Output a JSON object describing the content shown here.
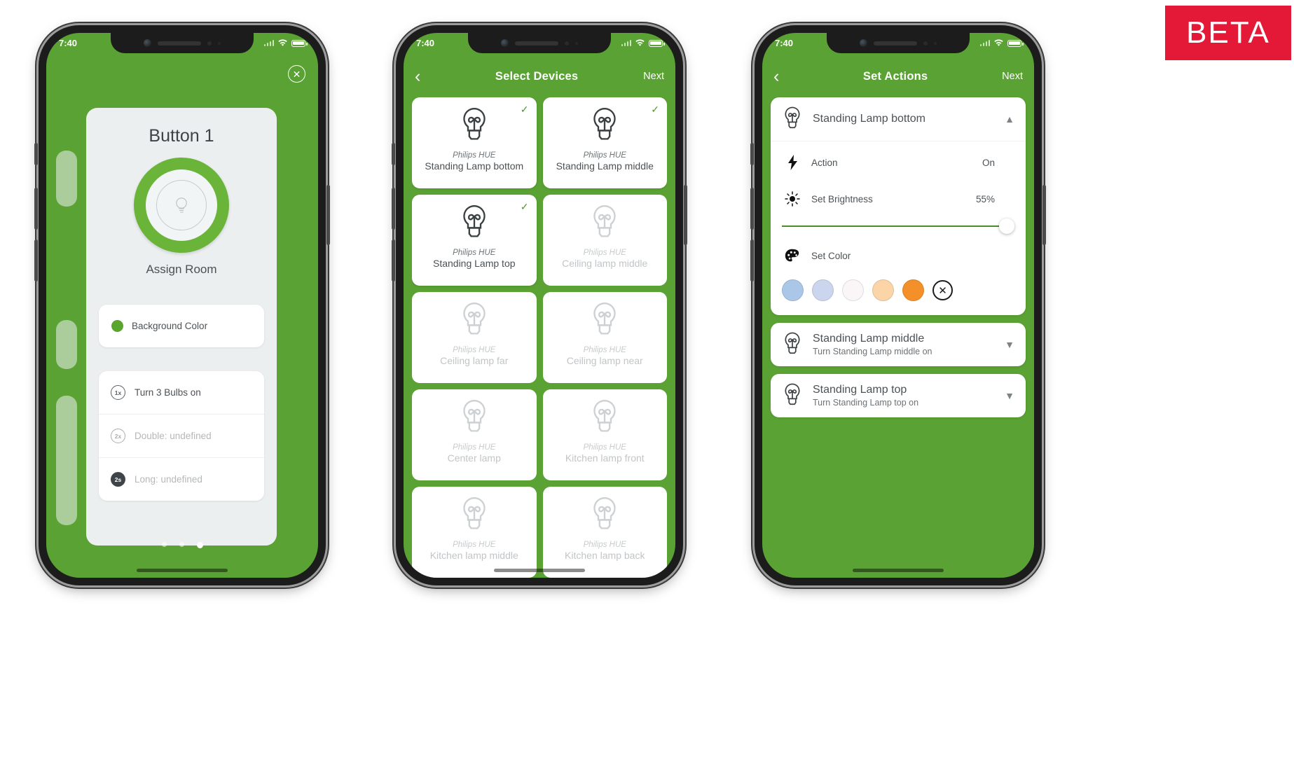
{
  "badge": {
    "label": "BETA",
    "color": "#e31937"
  },
  "theme": {
    "green": "#5aa233",
    "dial_green": "#6bb43a",
    "panel": "#eceff0",
    "text": "#4b5155"
  },
  "status_bar": {
    "time": "7:40"
  },
  "phone1": {
    "close_icon": "close-icon",
    "title": "Button 1",
    "assign_label": "Assign Room",
    "background_color": {
      "label": "Background Color",
      "swatch": "#5aa52c"
    },
    "actions": [
      {
        "badge": "1x",
        "label": "Turn 3 Bulbs on",
        "muted": false
      },
      {
        "badge": "2x",
        "label": "Double: undefined",
        "muted": true
      },
      {
        "badge": "2s",
        "label": "Long: undefined",
        "muted": true
      }
    ],
    "page_dots": 3,
    "active_dot": 3
  },
  "phone2": {
    "nav": {
      "back": "‹",
      "title": "Select Devices",
      "next": "Next"
    },
    "devices": [
      {
        "brand": "Philips HUE",
        "name": "Standing Lamp bottom",
        "selected": true
      },
      {
        "brand": "Philips HUE",
        "name": "Standing Lamp middle",
        "selected": true
      },
      {
        "brand": "Philips HUE",
        "name": "Standing Lamp top",
        "selected": true
      },
      {
        "brand": "Philips HUE",
        "name": "Ceiling lamp middle",
        "selected": false
      },
      {
        "brand": "Philips HUE",
        "name": "Ceiling lamp far",
        "selected": false
      },
      {
        "brand": "Philips HUE",
        "name": "Ceiling lamp near",
        "selected": false
      },
      {
        "brand": "Philips HUE",
        "name": "Center lamp",
        "selected": false
      },
      {
        "brand": "Philips HUE",
        "name": "Kitchen lamp front",
        "selected": false
      },
      {
        "brand": "Philips HUE",
        "name": "Kitchen lamp middle",
        "selected": false
      },
      {
        "brand": "Philips HUE",
        "name": "Kitchen lamp back",
        "selected": false
      }
    ]
  },
  "phone3": {
    "nav": {
      "back": "‹",
      "title": "Set Actions",
      "next": "Next"
    },
    "expanded": {
      "title": "Standing Lamp bottom",
      "chevron": "chevron-up-icon",
      "rows": [
        {
          "icon": "bolt-icon",
          "label": "Action",
          "value": "On"
        },
        {
          "icon": "brightness-icon",
          "label": "Set Brightness",
          "value": "55%"
        }
      ],
      "brightness_percent": 55,
      "color_row": {
        "icon": "palette-icon",
        "label": "Set Color",
        "current": "#ef8c33"
      },
      "palette": [
        "#aac7e8",
        "#ccd5ee",
        "#faf6f7",
        "#fbd4a8",
        "#f3902a"
      ],
      "clear_icon": "close-circle-icon"
    },
    "collapsed": [
      {
        "title": "Standing Lamp middle",
        "subtitle": "Turn Standing Lamp middle on",
        "chevron": "chevron-down-icon"
      },
      {
        "title": "Standing Lamp top",
        "subtitle": "Turn Standing Lamp top on",
        "chevron": "chevron-down-icon"
      }
    ]
  }
}
